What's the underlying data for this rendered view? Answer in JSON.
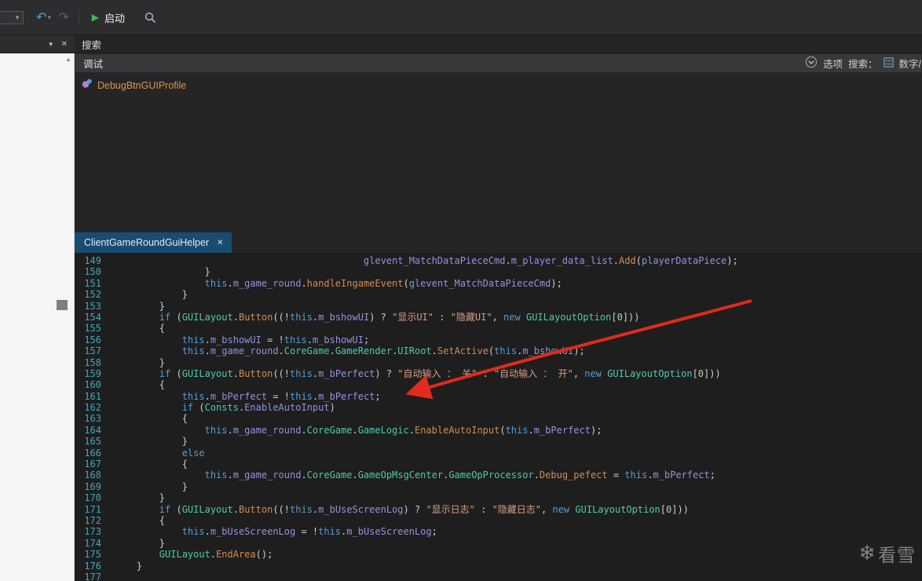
{
  "colors": {
    "toolbar-bg": "#2d2d30",
    "panel-bg": "#252526",
    "bar-bg": "#38383c",
    "editor-bg": "#1e1e1e",
    "left-bg": "#f5f5f5",
    "tab-active": "#1a4b70",
    "icon-blue": "#4aa3dd",
    "play-green": "#3dbb4f",
    "result-orange": "#e09148",
    "arrow-red": "#e02b1d",
    "lineno": "#3da8c5",
    "tok-plain": "#cfcfcf",
    "tok-kw": "#569cd6",
    "tok-field": "#9292e0",
    "tok-method": "#d18d52",
    "tok-type": "#4ec9b0",
    "tok-string": "#d69d85",
    "tok-number": "#b5cea8"
  },
  "toolbar": {
    "start_label": "启动"
  },
  "search_pane": {
    "title": "搜索",
    "scope_label": "调试",
    "options_label": "选项",
    "search_label": "搜索：",
    "search_type": "数字/",
    "result": "DebugBtnGUIProfile"
  },
  "editor": {
    "tab": "ClientGameRoundGuiHelper",
    "lines": [
      {
        "n": "149",
        "segs": [
          [
            "p",
            "                                            "
          ],
          [
            "f",
            "glevent_MatchDataPieceCmd"
          ],
          [
            "p",
            "."
          ],
          [
            "f",
            "m_player_data_list"
          ],
          [
            "p",
            "."
          ],
          [
            "m",
            "Add"
          ],
          [
            "p",
            "("
          ],
          [
            "f",
            "playerDataPiece"
          ],
          [
            "p",
            ");"
          ]
        ]
      },
      {
        "n": "150",
        "segs": [
          [
            "p",
            "                }"
          ]
        ]
      },
      {
        "n": "151",
        "segs": [
          [
            "p",
            "                "
          ],
          [
            "k",
            "this"
          ],
          [
            "p",
            "."
          ],
          [
            "f",
            "m_game_round"
          ],
          [
            "p",
            "."
          ],
          [
            "m",
            "handleIngameEvent"
          ],
          [
            "p",
            "("
          ],
          [
            "f",
            "glevent_MatchDataPieceCmd"
          ],
          [
            "p",
            ");"
          ]
        ]
      },
      {
        "n": "152",
        "segs": [
          [
            "p",
            "            }"
          ]
        ]
      },
      {
        "n": "153",
        "segs": [
          [
            "p",
            "        }"
          ]
        ]
      },
      {
        "n": "154",
        "segs": [
          [
            "p",
            "        "
          ],
          [
            "k",
            "if"
          ],
          [
            "p",
            " ("
          ],
          [
            "t",
            "GUILayout"
          ],
          [
            "p",
            "."
          ],
          [
            "m",
            "Button"
          ],
          [
            "p",
            "((!"
          ],
          [
            "k",
            "this"
          ],
          [
            "p",
            "."
          ],
          [
            "f",
            "m_bshowUI"
          ],
          [
            "p",
            ") ? "
          ],
          [
            "s",
            "\"显示UI\""
          ],
          [
            "p",
            " : "
          ],
          [
            "s",
            "\"隐藏UI\""
          ],
          [
            "p",
            ", "
          ],
          [
            "k",
            "new"
          ],
          [
            "p",
            " "
          ],
          [
            "t",
            "GUILayoutOption"
          ],
          [
            "p",
            "["
          ],
          [
            "n",
            "0"
          ],
          [
            "p",
            "]))"
          ]
        ]
      },
      {
        "n": "155",
        "segs": [
          [
            "p",
            "        {"
          ]
        ]
      },
      {
        "n": "156",
        "segs": [
          [
            "p",
            "            "
          ],
          [
            "k",
            "this"
          ],
          [
            "p",
            "."
          ],
          [
            "f",
            "m_bshowUI"
          ],
          [
            "p",
            " = !"
          ],
          [
            "k",
            "this"
          ],
          [
            "p",
            "."
          ],
          [
            "f",
            "m_bshowUI"
          ],
          [
            "p",
            ";"
          ]
        ]
      },
      {
        "n": "157",
        "segs": [
          [
            "p",
            "            "
          ],
          [
            "k",
            "this"
          ],
          [
            "p",
            "."
          ],
          [
            "f",
            "m_game_round"
          ],
          [
            "p",
            "."
          ],
          [
            "t",
            "CoreGame"
          ],
          [
            "p",
            "."
          ],
          [
            "t",
            "GameRender"
          ],
          [
            "p",
            "."
          ],
          [
            "t",
            "UIRoot"
          ],
          [
            "p",
            "."
          ],
          [
            "m",
            "SetActive"
          ],
          [
            "p",
            "("
          ],
          [
            "k",
            "this"
          ],
          [
            "p",
            "."
          ],
          [
            "f",
            "m_bshowUI"
          ],
          [
            "p",
            ");"
          ]
        ]
      },
      {
        "n": "158",
        "segs": [
          [
            "p",
            "        }"
          ]
        ]
      },
      {
        "n": "159",
        "segs": [
          [
            "p",
            "        "
          ],
          [
            "k",
            "if"
          ],
          [
            "p",
            " ("
          ],
          [
            "t",
            "GUILayout"
          ],
          [
            "p",
            "."
          ],
          [
            "m",
            "Button"
          ],
          [
            "p",
            "((!"
          ],
          [
            "k",
            "this"
          ],
          [
            "p",
            "."
          ],
          [
            "f",
            "m_bPerfect"
          ],
          [
            "p",
            ") ? "
          ],
          [
            "s",
            "\"自动输入 ： 关\""
          ],
          [
            "p",
            " : "
          ],
          [
            "s",
            "\"自动输入 ： 开\""
          ],
          [
            "p",
            ", "
          ],
          [
            "k",
            "new"
          ],
          [
            "p",
            " "
          ],
          [
            "t",
            "GUILayoutOption"
          ],
          [
            "p",
            "["
          ],
          [
            "n",
            "0"
          ],
          [
            "p",
            "]))"
          ]
        ]
      },
      {
        "n": "160",
        "segs": [
          [
            "p",
            "        {"
          ]
        ]
      },
      {
        "n": "161",
        "segs": [
          [
            "p",
            "            "
          ],
          [
            "k",
            "this"
          ],
          [
            "p",
            "."
          ],
          [
            "f",
            "m_bPerfect"
          ],
          [
            "p",
            " = !"
          ],
          [
            "k",
            "this"
          ],
          [
            "p",
            "."
          ],
          [
            "f",
            "m_bPerfect"
          ],
          [
            "p",
            ";"
          ]
        ]
      },
      {
        "n": "162",
        "segs": [
          [
            "p",
            "            "
          ],
          [
            "k",
            "if"
          ],
          [
            "p",
            " ("
          ],
          [
            "t",
            "Consts"
          ],
          [
            "p",
            "."
          ],
          [
            "f",
            "EnableAutoInput"
          ],
          [
            "p",
            ")"
          ]
        ]
      },
      {
        "n": "163",
        "segs": [
          [
            "p",
            "            {"
          ]
        ]
      },
      {
        "n": "164",
        "segs": [
          [
            "p",
            "                "
          ],
          [
            "k",
            "this"
          ],
          [
            "p",
            "."
          ],
          [
            "f",
            "m_game_round"
          ],
          [
            "p",
            "."
          ],
          [
            "t",
            "CoreGame"
          ],
          [
            "p",
            "."
          ],
          [
            "t",
            "GameLogic"
          ],
          [
            "p",
            "."
          ],
          [
            "m",
            "EnableAutoInput"
          ],
          [
            "p",
            "("
          ],
          [
            "k",
            "this"
          ],
          [
            "p",
            "."
          ],
          [
            "f",
            "m_bPerfect"
          ],
          [
            "p",
            ");"
          ]
        ]
      },
      {
        "n": "165",
        "segs": [
          [
            "p",
            "            }"
          ]
        ]
      },
      {
        "n": "166",
        "segs": [
          [
            "p",
            "            "
          ],
          [
            "k",
            "else"
          ]
        ]
      },
      {
        "n": "167",
        "segs": [
          [
            "p",
            "            {"
          ]
        ]
      },
      {
        "n": "168",
        "segs": [
          [
            "p",
            "                "
          ],
          [
            "k",
            "this"
          ],
          [
            "p",
            "."
          ],
          [
            "f",
            "m_game_round"
          ],
          [
            "p",
            "."
          ],
          [
            "t",
            "CoreGame"
          ],
          [
            "p",
            "."
          ],
          [
            "t",
            "GameOpMsgCenter"
          ],
          [
            "p",
            "."
          ],
          [
            "t",
            "GameOpProcessor"
          ],
          [
            "p",
            "."
          ],
          [
            "m",
            "Debug_pefect"
          ],
          [
            "p",
            " = "
          ],
          [
            "k",
            "this"
          ],
          [
            "p",
            "."
          ],
          [
            "f",
            "m_bPerfect"
          ],
          [
            "p",
            ";"
          ]
        ]
      },
      {
        "n": "169",
        "segs": [
          [
            "p",
            "            }"
          ]
        ]
      },
      {
        "n": "170",
        "segs": [
          [
            "p",
            "        }"
          ]
        ]
      },
      {
        "n": "171",
        "segs": [
          [
            "p",
            "        "
          ],
          [
            "k",
            "if"
          ],
          [
            "p",
            " ("
          ],
          [
            "t",
            "GUILayout"
          ],
          [
            "p",
            "."
          ],
          [
            "m",
            "Button"
          ],
          [
            "p",
            "((!"
          ],
          [
            "k",
            "this"
          ],
          [
            "p",
            "."
          ],
          [
            "f",
            "m_bUseScreenLog"
          ],
          [
            "p",
            ") ? "
          ],
          [
            "s",
            "\"显示日志\""
          ],
          [
            "p",
            " : "
          ],
          [
            "s",
            "\"隐藏日志\""
          ],
          [
            "p",
            ", "
          ],
          [
            "k",
            "new"
          ],
          [
            "p",
            " "
          ],
          [
            "t",
            "GUILayoutOption"
          ],
          [
            "p",
            "["
          ],
          [
            "n",
            "0"
          ],
          [
            "p",
            "]))"
          ]
        ]
      },
      {
        "n": "172",
        "segs": [
          [
            "p",
            "        {"
          ]
        ]
      },
      {
        "n": "173",
        "segs": [
          [
            "p",
            "            "
          ],
          [
            "k",
            "this"
          ],
          [
            "p",
            "."
          ],
          [
            "f",
            "m_bUseScreenLog"
          ],
          [
            "p",
            " = !"
          ],
          [
            "k",
            "this"
          ],
          [
            "p",
            "."
          ],
          [
            "f",
            "m_bUseScreenLog"
          ],
          [
            "p",
            ";"
          ]
        ]
      },
      {
        "n": "174",
        "segs": [
          [
            "p",
            "        }"
          ]
        ]
      },
      {
        "n": "175",
        "segs": [
          [
            "p",
            "        "
          ],
          [
            "t",
            "GUILayout"
          ],
          [
            "p",
            "."
          ],
          [
            "m",
            "EndArea"
          ],
          [
            "p",
            "();"
          ]
        ]
      },
      {
        "n": "176",
        "segs": [
          [
            "p",
            "    }"
          ]
        ]
      },
      {
        "n": "177",
        "segs": []
      }
    ]
  },
  "watermark": {
    "icon": "❄",
    "text": "看雪"
  }
}
